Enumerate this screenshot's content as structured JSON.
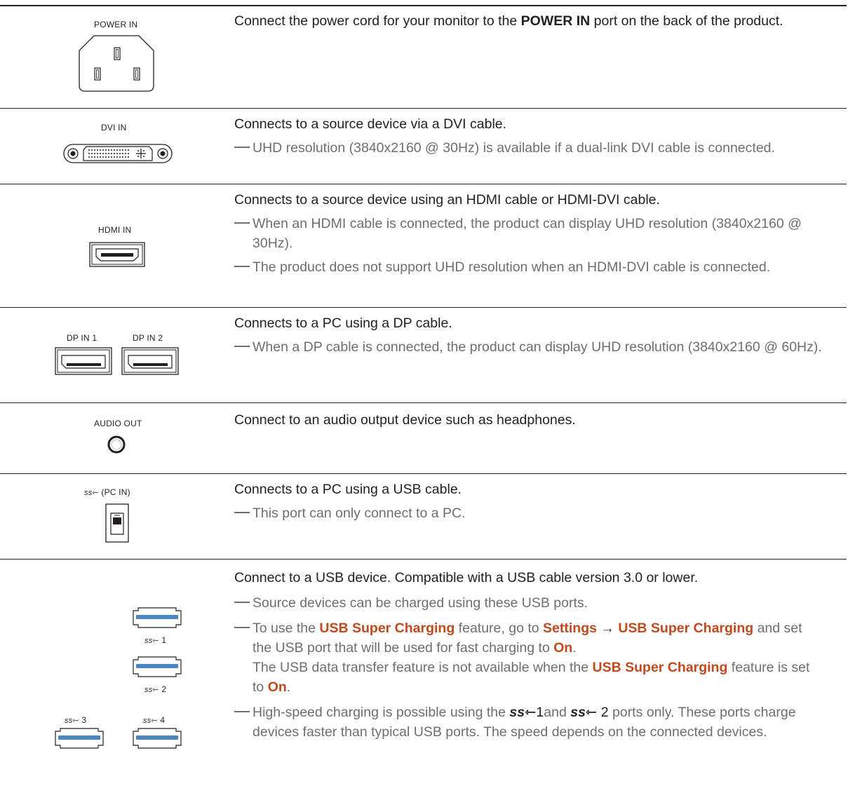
{
  "rows": [
    {
      "port_label": "POWER IN",
      "main_before": "Connect the power cord for your monitor to the ",
      "main_bold": "POWER IN",
      "main_after": " port on the back of the product."
    },
    {
      "port_label": "DVI IN",
      "main": "Connects to a source device via a DVI cable.",
      "notes": [
        "UHD resolution (3840x2160 @ 30Hz) is available if a dual-link DVI cable is connected."
      ]
    },
    {
      "port_label": "HDMI IN",
      "main": "Connects to a source device using an HDMI cable or HDMI-DVI cable.",
      "notes": [
        "When an HDMI cable is connected, the product can display UHD resolution (3840x2160 @ 30Hz).",
        "The product does not support UHD resolution when an HDMI-DVI cable is connected."
      ]
    },
    {
      "port_labels": [
        "DP IN 1",
        "DP IN 2"
      ],
      "main": "Connects to a PC using a DP cable.",
      "notes": [
        "When a DP cable is connected, the product can display UHD resolution (3840x2160 @ 60Hz)."
      ]
    },
    {
      "port_label": "AUDIO OUT",
      "main": "Connect to an audio output device such as headphones."
    },
    {
      "port_label": "(PC IN)",
      "main": "Connects to a PC using a USB cable.",
      "notes": [
        "This port can only connect to a PC."
      ]
    },
    {
      "port_labels": [
        "1",
        "2",
        "3",
        "4"
      ],
      "main": "Connect to a USB device. Compatible with a USB cable version 3.0 or lower.",
      "note1": "Source devices can be charged using these USB ports.",
      "note2": {
        "t1": "To use the ",
        "b1": "USB Super Charging",
        "t2": " feature, go to ",
        "b2": "Settings",
        "arrow": " → ",
        "b3": "USB Super Charging",
        "t3": " and set the USB port that will be used for fast charging to ",
        "b4": "On",
        "t4": ".",
        "t5": "The USB data transfer feature is not available when the ",
        "b5": "USB Super Charging",
        "t6": " feature is set to ",
        "b6": "On",
        "t7": "."
      },
      "note3": {
        "t1": "High-speed charging is possible using the ",
        "p1": "1",
        "t2": "and ",
        "p2": "2",
        "t3": " ports only. These ports charge devices faster than typical USB ports. The speed depends on the connected devices."
      }
    }
  ],
  "icons": {
    "superspeed_logo": "ss-usb-icon",
    "accent_color": "#c2491d",
    "usb_blue": "#4a86c5"
  }
}
